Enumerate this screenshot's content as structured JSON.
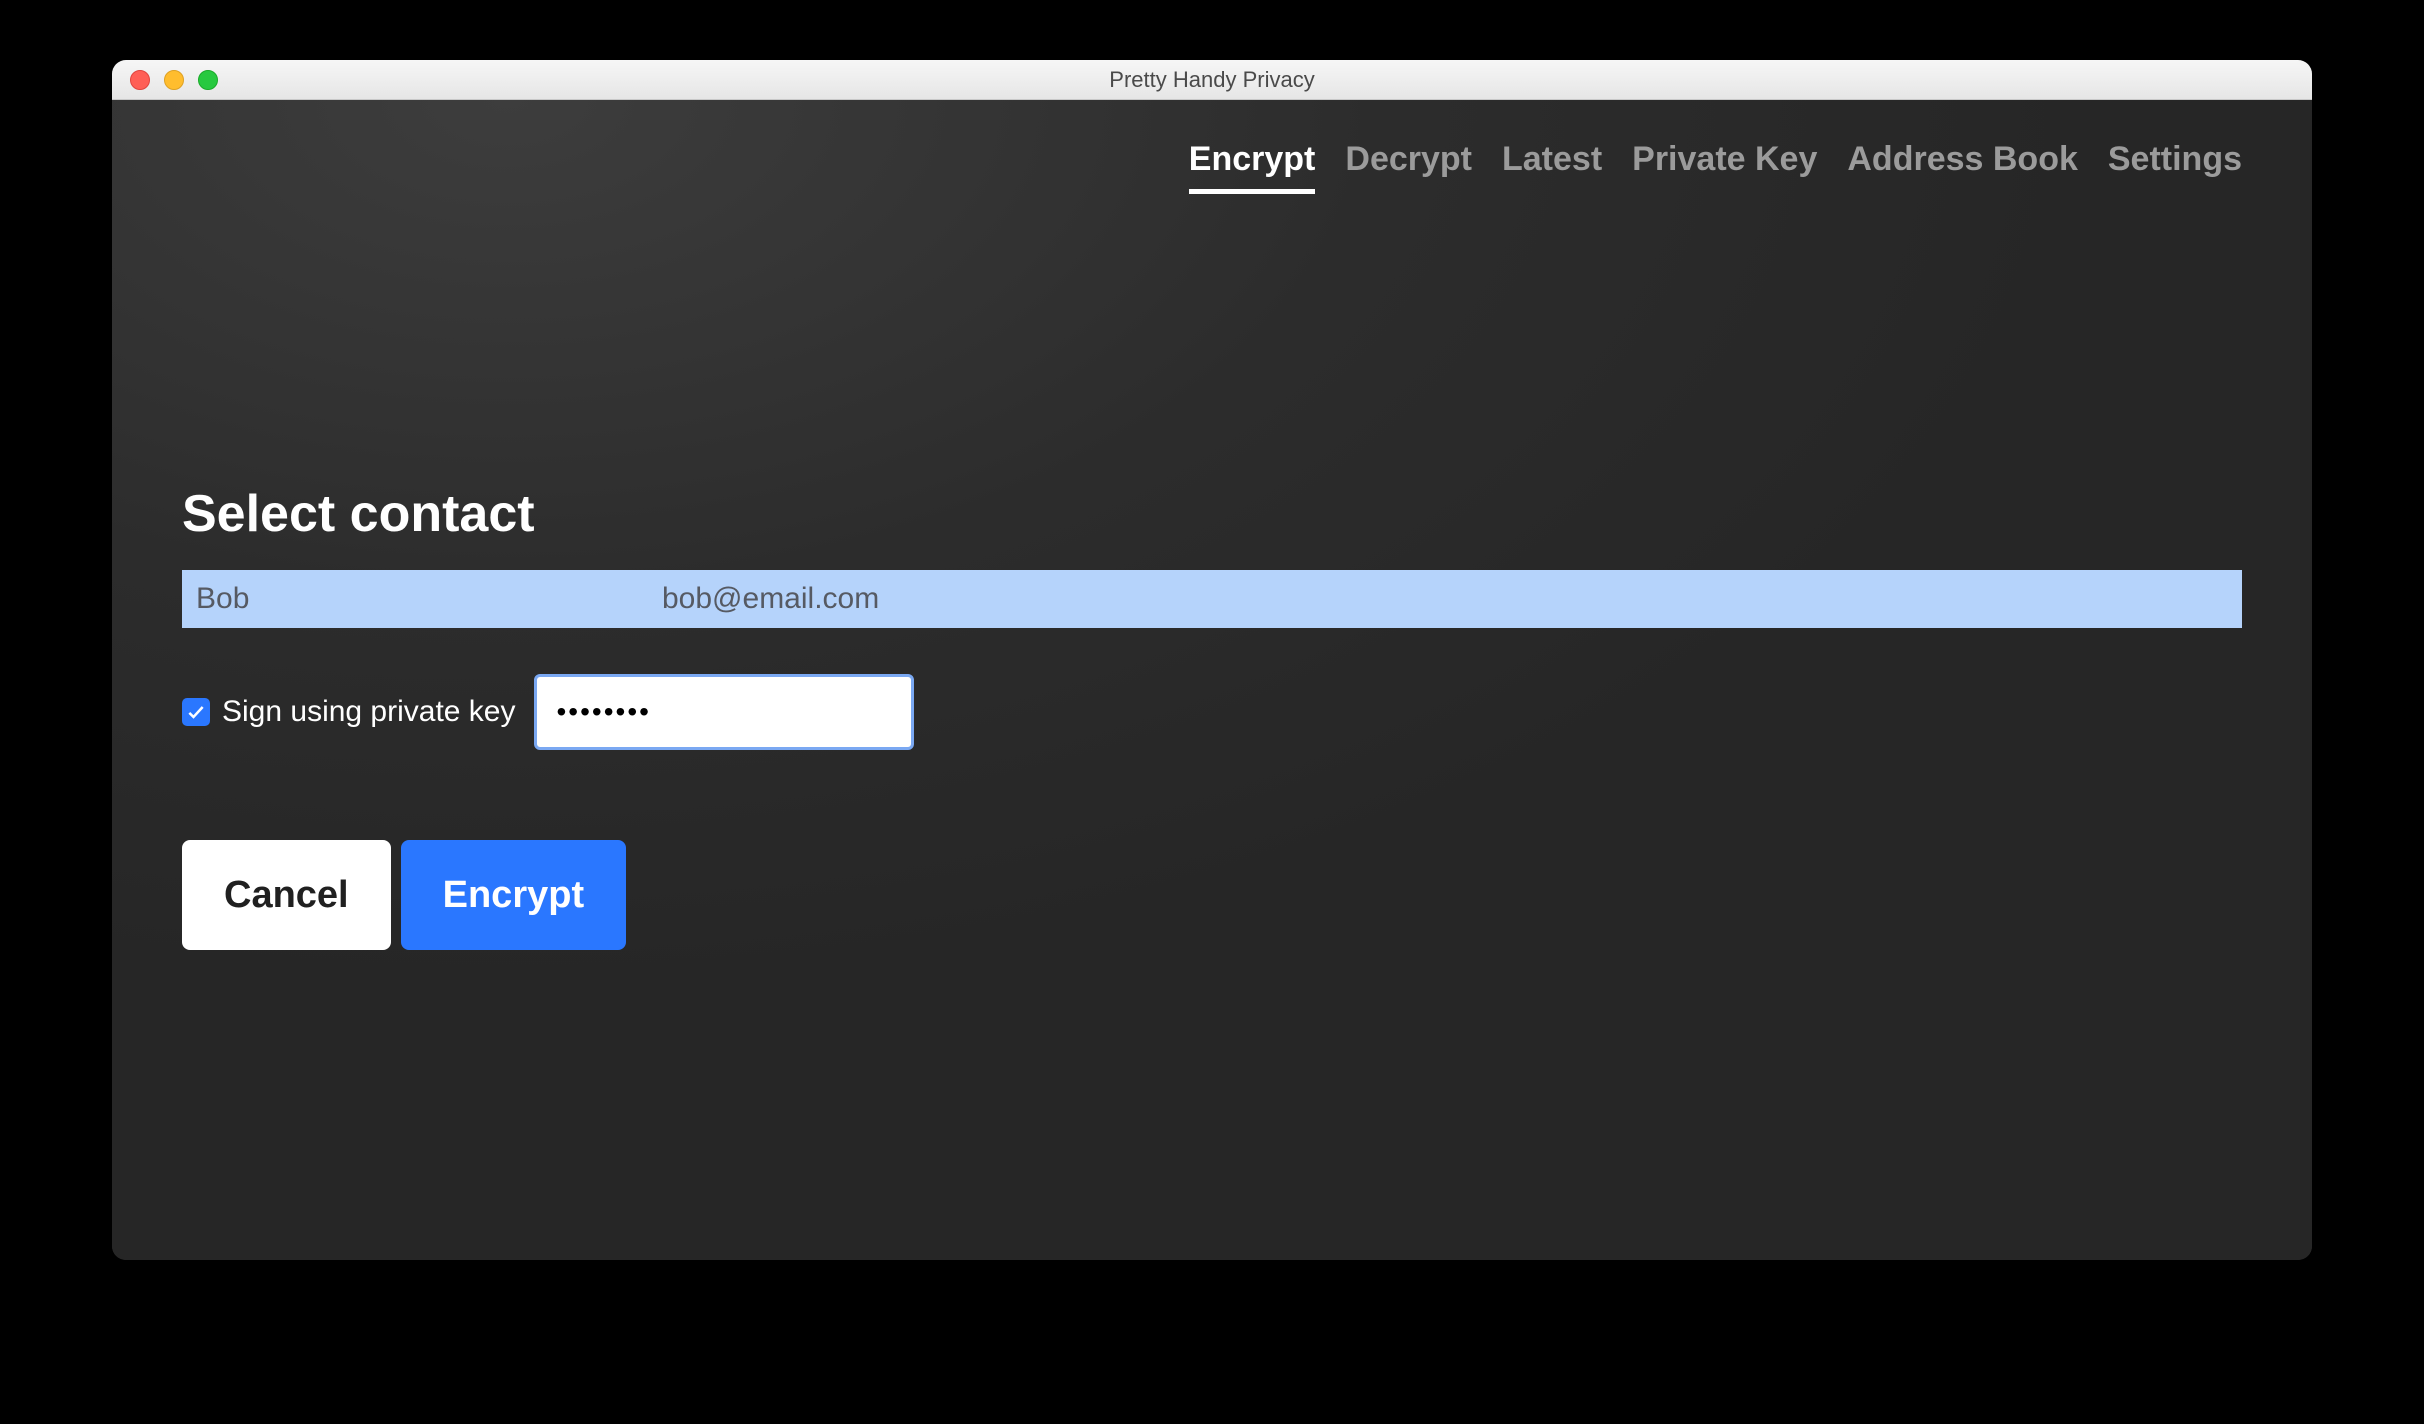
{
  "window": {
    "title": "Pretty Handy Privacy"
  },
  "tabs": [
    {
      "label": "Encrypt",
      "active": true
    },
    {
      "label": "Decrypt",
      "active": false
    },
    {
      "label": "Latest",
      "active": false
    },
    {
      "label": "Private Key",
      "active": false
    },
    {
      "label": "Address Book",
      "active": false
    },
    {
      "label": "Settings",
      "active": false
    }
  ],
  "main": {
    "heading": "Select contact",
    "contacts": [
      {
        "name": "Bob",
        "email": "bob@email.com",
        "selected": true
      }
    ],
    "sign": {
      "checked": true,
      "label": "Sign using private key",
      "password_value": "••••••••"
    },
    "buttons": {
      "cancel": "Cancel",
      "encrypt": "Encrypt"
    }
  },
  "colors": {
    "accent": "#2a77ff",
    "selection": "#b5d3fb",
    "bg": "#2e2e2e"
  }
}
